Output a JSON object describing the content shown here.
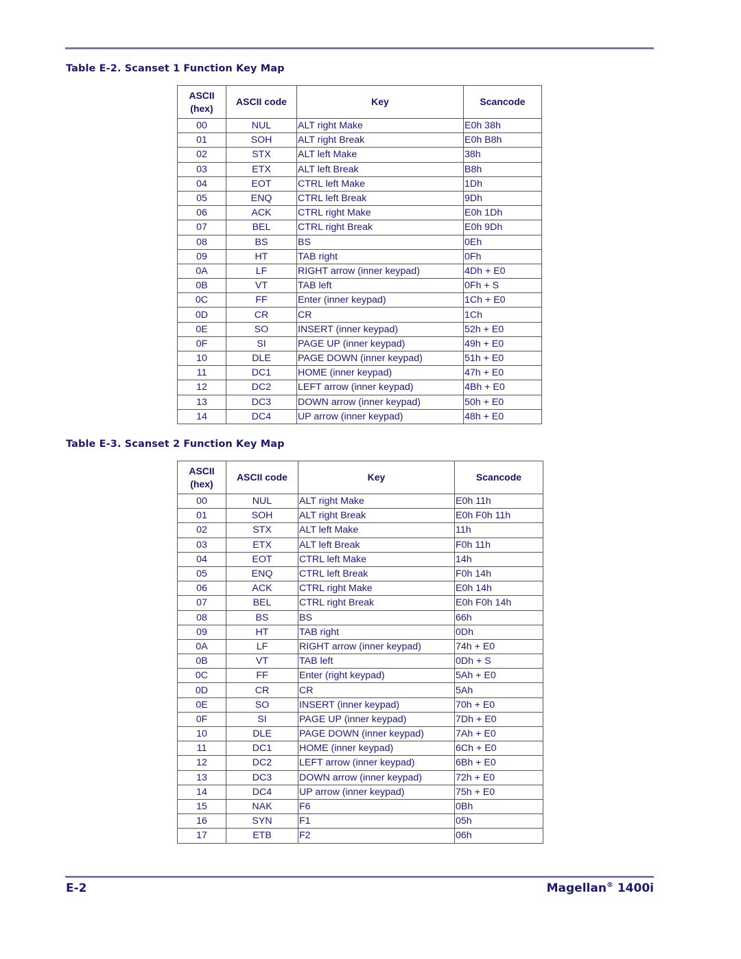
{
  "page": {
    "footer_page": "E-2",
    "footer_product_name": "Magellan",
    "footer_product_mark": "®",
    "footer_product_model": " 1400i"
  },
  "colors": {
    "text": "#1a1a6e",
    "rule": "#6a6aa0"
  },
  "tables": [
    {
      "caption": "Table E-2. Scanset 1 Function Key Map",
      "headers": {
        "hex_line1": "ASCII",
        "hex_line2": "(hex)",
        "code": "ASCII code",
        "key": "Key",
        "scancode": "Scancode"
      },
      "rows": [
        [
          "00",
          "NUL",
          "ALT right Make",
          "E0h 38h"
        ],
        [
          "01",
          "SOH",
          "ALT right Break",
          "E0h B8h"
        ],
        [
          "02",
          "STX",
          "ALT left Make",
          "38h"
        ],
        [
          "03",
          "ETX",
          "ALT left Break",
          "B8h"
        ],
        [
          "04",
          "EOT",
          "CTRL left Make",
          "1Dh"
        ],
        [
          "05",
          "ENQ",
          "CTRL left Break",
          "9Dh"
        ],
        [
          "06",
          "ACK",
          "CTRL right Make",
          "E0h 1Dh"
        ],
        [
          "07",
          "BEL",
          "CTRL right Break",
          "E0h 9Dh"
        ],
        [
          "08",
          "BS",
          "BS",
          "0Eh"
        ],
        [
          "09",
          "HT",
          "TAB right",
          "0Fh"
        ],
        [
          "0A",
          "LF",
          "RIGHT arrow (inner keypad)",
          "4Dh + E0"
        ],
        [
          "0B",
          "VT",
          "TAB left",
          "0Fh + S"
        ],
        [
          "0C",
          "FF",
          "Enter (inner keypad)",
          "1Ch + E0"
        ],
        [
          "0D",
          "CR",
          "CR",
          "1Ch"
        ],
        [
          "0E",
          "SO",
          "INSERT (inner keypad)",
          "52h + E0"
        ],
        [
          "0F",
          "SI",
          "PAGE UP (inner keypad)",
          "49h + E0"
        ],
        [
          "10",
          "DLE",
          "PAGE DOWN (inner keypad)",
          "51h + E0"
        ],
        [
          "11",
          "DC1",
          "HOME (inner keypad)",
          "47h + E0"
        ],
        [
          "12",
          "DC2",
          "LEFT arrow (inner keypad)",
          "4Bh + E0"
        ],
        [
          "13",
          "DC3",
          "DOWN arrow (inner keypad)",
          "50h + E0"
        ],
        [
          "14",
          "DC4",
          "UP arrow (inner keypad)",
          "48h + E0"
        ]
      ]
    },
    {
      "caption": "Table E-3. Scanset 2 Function Key Map",
      "headers": {
        "hex_line1": "ASCII",
        "hex_line2": "(hex)",
        "code": "ASCII code",
        "key": "Key",
        "scancode": "Scancode"
      },
      "rows": [
        [
          "00",
          "NUL",
          "ALT right Make",
          "E0h 11h"
        ],
        [
          "01",
          "SOH",
          "ALT right Break",
          "E0h F0h 11h"
        ],
        [
          "02",
          "STX",
          "ALT left Make",
          "11h"
        ],
        [
          "03",
          "ETX",
          "ALT left Break",
          "F0h 11h"
        ],
        [
          "04",
          "EOT",
          "CTRL left Make",
          "14h"
        ],
        [
          "05",
          "ENQ",
          "CTRL left Break",
          "F0h 14h"
        ],
        [
          "06",
          "ACK",
          "CTRL right Make",
          "E0h 14h"
        ],
        [
          "07",
          "BEL",
          "CTRL right Break",
          "E0h F0h 14h"
        ],
        [
          "08",
          "BS",
          "BS",
          "66h"
        ],
        [
          "09",
          "HT",
          "TAB right",
          "0Dh"
        ],
        [
          "0A",
          "LF",
          "RIGHT arrow (inner keypad)",
          "74h + E0"
        ],
        [
          "0B",
          "VT",
          "TAB left",
          "0Dh + S"
        ],
        [
          "0C",
          "FF",
          "Enter (right keypad)",
          "5Ah + E0"
        ],
        [
          "0D",
          "CR",
          "CR",
          "5Ah"
        ],
        [
          "0E",
          "SO",
          "INSERT (inner keypad)",
          "70h + E0"
        ],
        [
          "0F",
          "SI",
          "PAGE UP (inner keypad)",
          "7Dh + E0"
        ],
        [
          "10",
          "DLE",
          "PAGE DOWN (inner keypad)",
          "7Ah + E0"
        ],
        [
          "11",
          "DC1",
          "HOME (inner keypad)",
          "6Ch + E0"
        ],
        [
          "12",
          "DC2",
          "LEFT arrow (inner keypad)",
          "6Bh + E0"
        ],
        [
          "13",
          "DC3",
          "DOWN arrow (inner keypad)",
          "72h + E0"
        ],
        [
          "14",
          "DC4",
          "UP arrow (inner keypad)",
          "75h + E0"
        ],
        [
          "15",
          "NAK",
          "F6",
          "0Bh"
        ],
        [
          "16",
          "SYN",
          "F1",
          "05h"
        ],
        [
          "17",
          "ETB",
          "F2",
          "06h"
        ]
      ]
    }
  ]
}
